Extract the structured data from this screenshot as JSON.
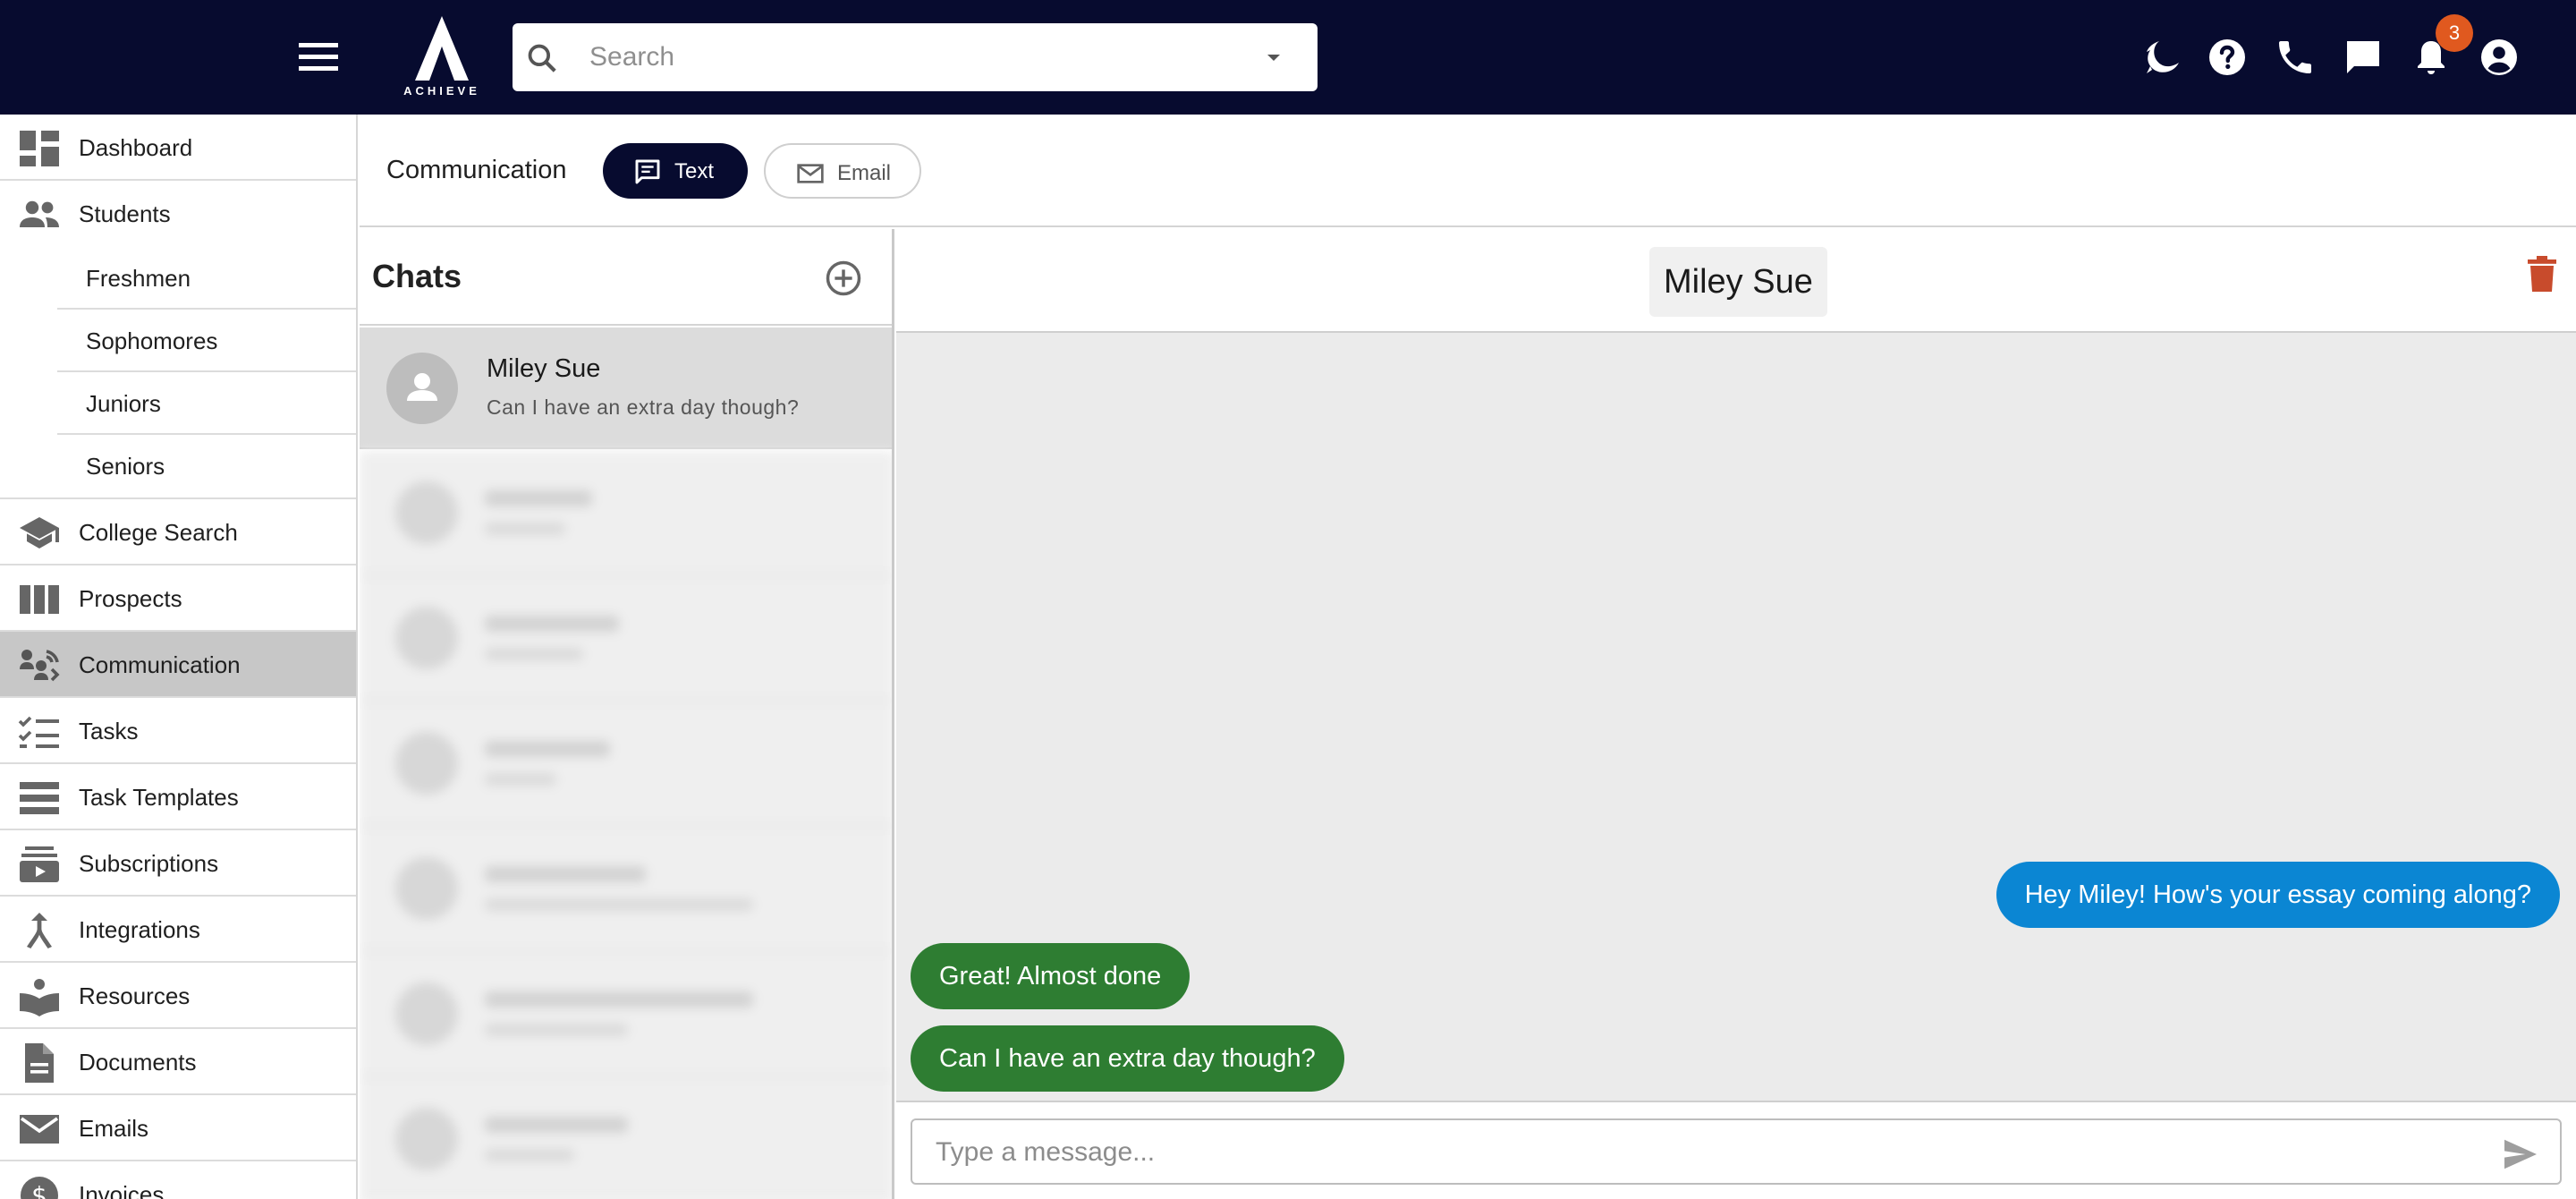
{
  "topbar": {
    "logo_text": "ACHIEVE",
    "search_placeholder": "Search",
    "notification_count": "3",
    "icons": [
      "menu-icon",
      "search-icon",
      "dropdown-caret-icon",
      "dark-mode-icon",
      "help-icon",
      "phone-icon",
      "chat-icon",
      "bell-icon",
      "account-icon"
    ]
  },
  "sidebar": {
    "items": [
      {
        "label": "Dashboard",
        "icon": "dashboard-icon"
      },
      {
        "label": "Students",
        "icon": "people-icon"
      },
      {
        "label": "College Search",
        "icon": "school-icon"
      },
      {
        "label": "Prospects",
        "icon": "columns-icon"
      },
      {
        "label": "Communication",
        "icon": "communication-icon",
        "active": true
      },
      {
        "label": "Tasks",
        "icon": "checklist-icon"
      },
      {
        "label": "Task Templates",
        "icon": "list-icon"
      },
      {
        "label": "Subscriptions",
        "icon": "subscriptions-icon"
      },
      {
        "label": "Integrations",
        "icon": "merge-icon"
      },
      {
        "label": "Resources",
        "icon": "book-icon"
      },
      {
        "label": "Documents",
        "icon": "document-icon"
      },
      {
        "label": "Emails",
        "icon": "mail-icon"
      },
      {
        "label": "Invoices",
        "icon": "dollar-icon"
      }
    ],
    "student_subitems": [
      "Freshmen",
      "Sophomores",
      "Juniors",
      "Seniors"
    ]
  },
  "communication": {
    "title": "Communication",
    "tabs": [
      {
        "label": "Text",
        "icon": "message-icon",
        "selected": true
      },
      {
        "label": "Email",
        "icon": "mail-icon",
        "selected": false
      }
    ]
  },
  "chats": {
    "title": "Chats",
    "items": [
      {
        "name": "Miley Sue",
        "preview": "Can I have an extra day though?"
      }
    ]
  },
  "conversation": {
    "contact_name": "Miley Sue",
    "messages": [
      {
        "text": "Hey Miley! How's your essay coming along?",
        "direction": "outgoing"
      },
      {
        "text": "Great! Almost done",
        "direction": "incoming"
      },
      {
        "text": "Can I have an extra day though?",
        "direction": "incoming"
      }
    ],
    "composer_placeholder": "Type a message..."
  },
  "colors": {
    "topbar": "#070b2f",
    "outgoing_bubble": "#0b86d3",
    "incoming_bubble": "#2e7d32",
    "badge": "#e0591f",
    "trash": "#c84b2c"
  }
}
